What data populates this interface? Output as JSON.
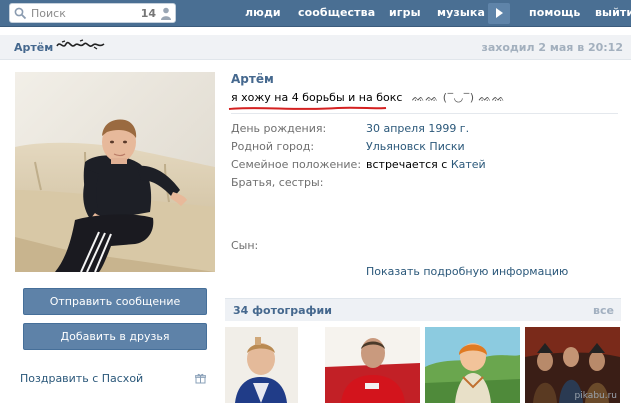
{
  "topbar": {
    "search_placeholder": "Поиск",
    "search_count": "14",
    "nav": [
      "люди",
      "сообщества",
      "игры",
      "музыка",
      "помощь",
      "выйти"
    ]
  },
  "profile_header": {
    "name": "Артём",
    "last_seen": "заходил 2 мая в 20:12"
  },
  "profile": {
    "name": "Артём",
    "status": "я хожу на 4 борьбы и на бокс",
    "status_deco": "ᨐᨐ (‾◡‾) ᨐᨐ",
    "info": [
      {
        "label": "День рождения:",
        "value": "30 апреля 1999 г.",
        "type": "link"
      },
      {
        "label": "Родной город:",
        "value": "Ульяновск Писки",
        "type": "link"
      },
      {
        "label": "Семейное положение:",
        "value_prefix": "встречается с ",
        "value_link": "Катей",
        "type": "mixed"
      },
      {
        "label": "Братья, сестры:",
        "value": "",
        "type": "text"
      },
      {
        "label": "Сын:",
        "value": "",
        "type": "text"
      }
    ],
    "show_more": "Показать подробную информацию"
  },
  "actions": {
    "send_message": "Отправить сообщение",
    "add_friend": "Добавить в друзья",
    "congratulate": "Поздравить с Пасхой"
  },
  "photos": {
    "title": "34 фотографии",
    "all": "все"
  },
  "watermark": "pikabu.ru",
  "colors": {
    "topbar": "#4a6f93",
    "link": "#2b587a",
    "button": "#5e82a8",
    "status_underline": "#d42020"
  }
}
